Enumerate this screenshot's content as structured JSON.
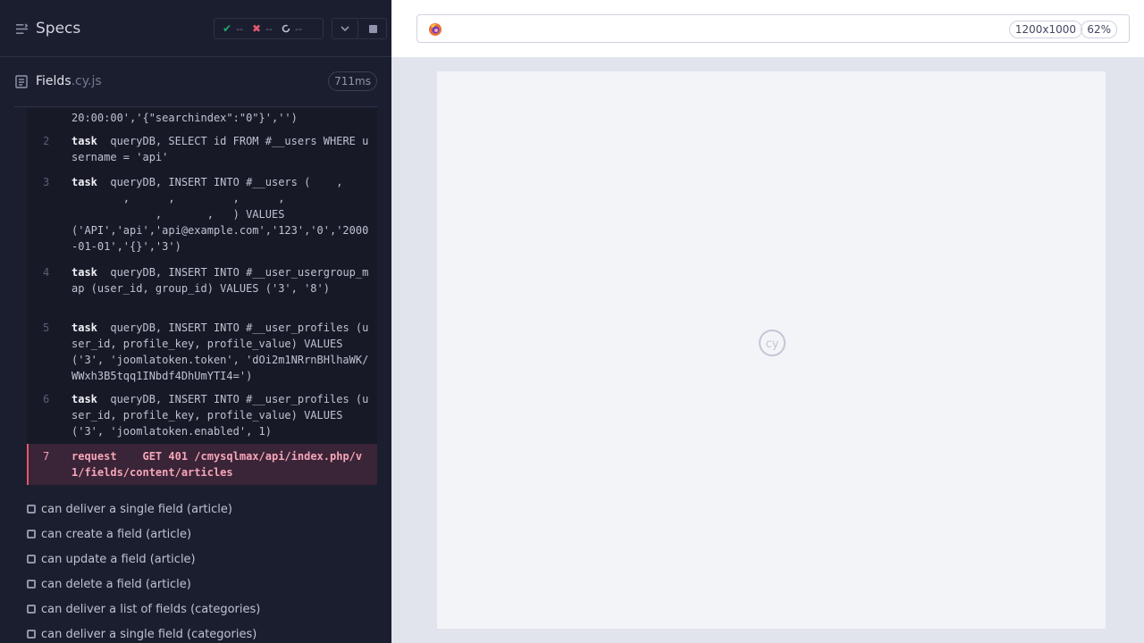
{
  "reporter": {
    "specs_label": "Specs",
    "stats": {
      "passed": "--",
      "failed": "--",
      "pending": "--"
    },
    "file": {
      "name": "Fields",
      "ext": ".cy.js",
      "duration": "711ms"
    },
    "commands": [
      {
        "num": "",
        "keyword": "",
        "text": "20:00:00','{\"searchindex\":\"0\"}','')"
      },
      {
        "num": "2",
        "keyword": "task",
        "text": "queryDB, SELECT id FROM #__users WHERE username = 'api'"
      },
      {
        "num": "3",
        "keyword": "task",
        "text": "queryDB, INSERT INTO #__users (    ,\n        ,      ,         ,      ,\n             ,       ,   ) VALUES\n('API','api','api@example.com','123','0','2000-01-01','{}','3')"
      },
      {
        "num": "4",
        "keyword": "task",
        "text": "queryDB, INSERT INTO #__user_usergroup_map (user_id, group_id) VALUES ('3', '8')"
      },
      {
        "num": "5",
        "keyword": "task",
        "text": "queryDB, INSERT INTO #__user_profiles (user_id, profile_key, profile_value) VALUES ('3', 'joomlatoken.token', 'dOi2m1NRrnBHlhaWK/WWxh3B5tqq1INbdf4DhUmYTI4=')"
      },
      {
        "num": "6",
        "keyword": "task",
        "text": "queryDB, INSERT INTO #__user_profiles (user_id, profile_key, profile_value) VALUES ('3', 'joomlatoken.enabled', 1)"
      },
      {
        "num": "7",
        "keyword": "request",
        "text": "GET 401 /cmysqlmax/api/index.php/v1/fields/content/articles"
      }
    ],
    "tests": [
      "can deliver a single field (article)",
      "can create a field (article)",
      "can update a field (article)",
      "can delete a field (article)",
      "can deliver a list of fields (categories)",
      "can deliver a single field (categories)"
    ]
  },
  "runner": {
    "viewport": "1200x1000",
    "zoom": "62%",
    "logo_text": "cy"
  },
  "colors": {
    "passed": "#1fa971",
    "failed": "#e45770",
    "background": "#1b1e2e"
  },
  "icons": [
    "specs-menu-icon",
    "check-icon",
    "x-icon",
    "pending-spinner-icon",
    "chevron-down-icon",
    "stop-icon",
    "file-icon",
    "firefox-icon",
    "cypress-logo-icon"
  ]
}
